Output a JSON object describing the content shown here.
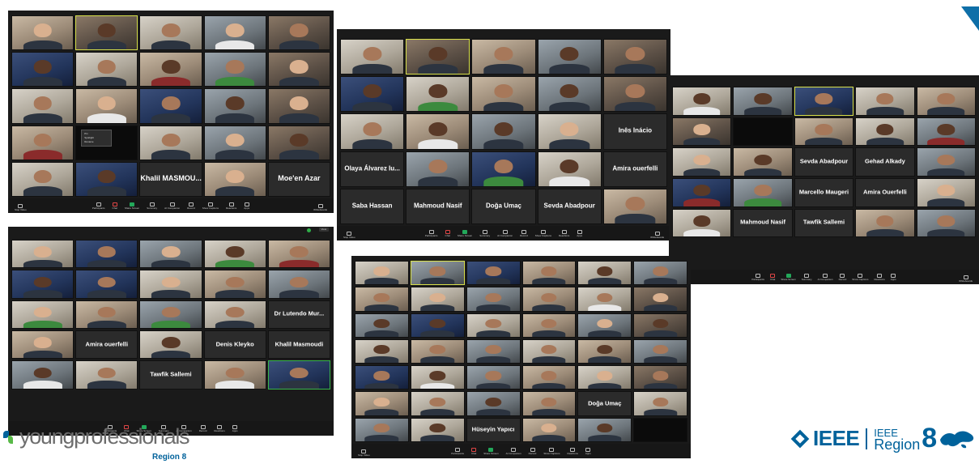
{
  "brand": {
    "yp_wordmark": "youngprofessionals",
    "yp_region": "Region 8",
    "ieee_word": "IEEE",
    "ieee_small_top": "IEEE",
    "ieee_small_bottom": "Region",
    "ieee_region_num": "8",
    "accent": "#00629b",
    "green": "#58b947"
  },
  "toolbar": {
    "left": "Stop Video",
    "items": [
      "Participants",
      "Chat",
      "Share Screen",
      "Summary",
      "AI Companion",
      "Record",
      "Show Captions",
      "Reactions",
      "Apps"
    ],
    "right": "Whiteboards"
  },
  "shot1": {
    "names": [
      "",
      "",
      "",
      "",
      "",
      "",
      "",
      "",
      "",
      "",
      "",
      "",
      "",
      "",
      "",
      "",
      "",
      "",
      "",
      "",
      "",
      "",
      "",
      "",
      ""
    ],
    "texts": {
      "khalil": "Khalil MASMOU...",
      "moe": "Moe'en Azar"
    },
    "popup": [
      "Pin",
      "Spotlight",
      "Rename"
    ]
  },
  "shot2": {
    "texts": {
      "ines": "Inês Inácio",
      "olaya": "Olaya Álvarez Iu...",
      "amira": "Amira ouerfelli",
      "saba": "Saba Hassan",
      "mahmoud": "Mahmoud Nasif",
      "doga": "Doğa Umaç",
      "sevda": "Sevda Abadpour"
    }
  },
  "shot3": {
    "texts": {
      "sevda": "Sevda Abadpour",
      "gehad": "Gehad Alkady",
      "marcello": "Marcello Maugeri",
      "amira": "Amira Ouerfelli",
      "mahmoud": "Mahmoud Nasif",
      "tawfik": "Tawfik Sallemi"
    }
  },
  "shot4": {
    "texts": {
      "lutendo": "Dr Lutendo Mur...",
      "amira": "Amira ouerfelli",
      "denis": "Denis Kleyko",
      "khalil": "Khalil Masmoudi",
      "tawfik": "Tawfik Sallemi"
    },
    "view": "View"
  },
  "shot5": {
    "texts": {
      "doga": "Doğa Umaç",
      "huseyin": "Hüseyin Yapıcı"
    }
  }
}
